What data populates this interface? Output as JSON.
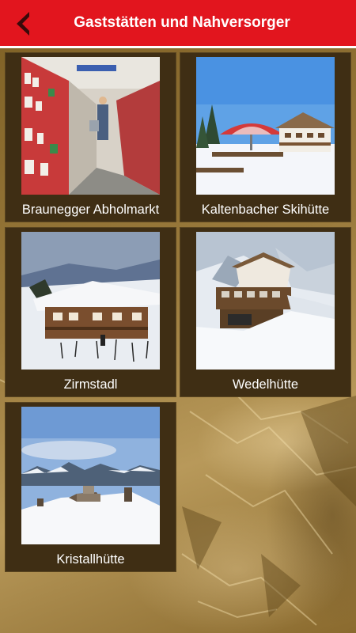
{
  "header": {
    "title": "Gaststätten und Nahversorger",
    "back_icon": "back-arrow-icon",
    "color": "#e2151e"
  },
  "tiles": [
    {
      "label": "Braunegger Abholmarkt",
      "image": "supermarket-aisle-photo"
    },
    {
      "label": "Kaltenbacher Skihütte",
      "image": "ski-hut-terrace-photo"
    },
    {
      "label": "Zirmstadl",
      "image": "chalet-in-snow-photo"
    },
    {
      "label": "Wedelhütte",
      "image": "mountain-lodge-photo"
    },
    {
      "label": "Kristallhütte",
      "image": "summit-hut-panorama-photo"
    }
  ],
  "colors": {
    "tile_background": "#3f2e14",
    "page_background": "#8a6a2e"
  }
}
